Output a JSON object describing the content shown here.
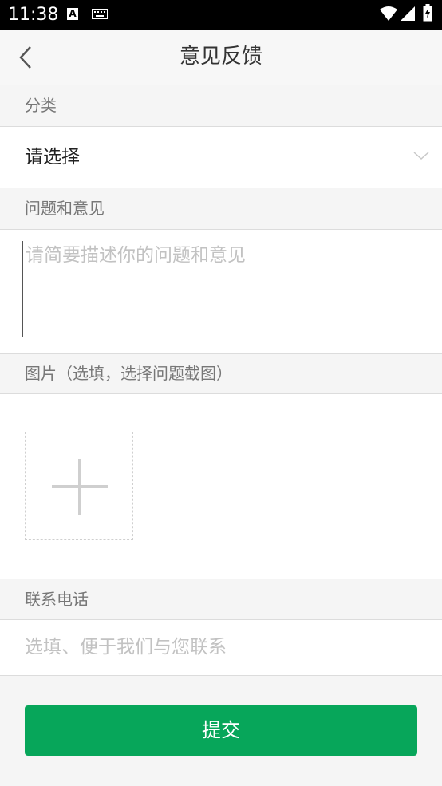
{
  "status_bar": {
    "time": "11:38",
    "icons": [
      "a-icon",
      "keyboard-icon",
      "wifi-icon",
      "signal-icon",
      "battery-charging-icon"
    ]
  },
  "nav": {
    "back_icon": "chevron-left-icon",
    "title": "意见反馈"
  },
  "category": {
    "header": "分类",
    "value": "请选择",
    "icon": "chevron-down-icon"
  },
  "feedback": {
    "header": "问题和意见",
    "placeholder": "请简要描述你的问题和意见",
    "value": ""
  },
  "images": {
    "header": "图片（选填，选择问题截图）",
    "add_icon": "plus-icon"
  },
  "contact": {
    "header": "联系电话",
    "placeholder": "选填、便于我们与您联系",
    "value": ""
  },
  "submit_label": "提交",
  "colors": {
    "accent": "#07a65a",
    "status_bar": "#000000",
    "background": "#f5f5f5"
  }
}
